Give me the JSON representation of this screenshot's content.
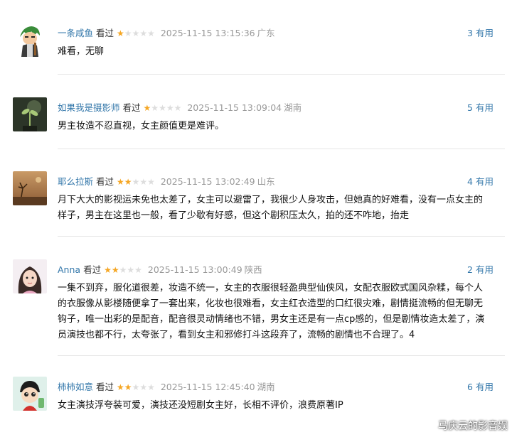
{
  "comments": [
    {
      "user": "一条咸鱼",
      "status": "看过",
      "rating": 1,
      "time": "2025-11-15 13:15:36",
      "location": "广东",
      "votes": "3",
      "vote_label": "有用",
      "text": "难看，无聊",
      "avatar": "anime-character-avatar"
    },
    {
      "user": "如果我是摄影师",
      "status": "看过",
      "rating": 1,
      "time": "2025-11-15 13:09:04",
      "location": "湖南",
      "votes": "5",
      "vote_label": "有用",
      "text": "男主妆造不忍直视，女主颜值更是难评。",
      "avatar": "plant-photo-avatar"
    },
    {
      "user": "耶么拉斯",
      "status": "看过",
      "rating": 2,
      "time": "2025-11-15 13:02:49",
      "location": "山东",
      "votes": "4",
      "vote_label": "有用",
      "text": "月下大大的影视运未免也太差了，女主可以避雷了，我很少人身攻击，但她真的好难看，没有一点女主的样子，男主在这里也一般，看了少歇有好感，但这个剧积压太久，拍的还不咋地，抬走",
      "avatar": "desert-tree-avatar"
    },
    {
      "user": "Anna",
      "status": "看过",
      "rating": 2,
      "time": "2025-11-15 13:00:49",
      "location": "陕西",
      "votes": "2",
      "vote_label": "有用",
      "text": "一集不到弃，服化道很差，妆造不统一，女主的衣服很轻盈典型仙侠风，女配衣服欧式国风杂糅，每个人的衣服像从影楼随便拿了一套出来，化妆也很难看，女主红衣造型的口红很灾难，剧情挺流畅的但无聊无钩子，唯一出彩的是配音，配音很灵动情绪也不错，男女主还是有一点cp感的，但是剧情妆造太差了，演员演技也都不行，太夸张了，看到女主和邪修打斗这段弃了，流畅的剧情也不合理了。4",
      "avatar": "girl-portrait-avatar"
    },
    {
      "user": "柿柿如意",
      "status": "看过",
      "rating": 2,
      "time": "2025-11-15 12:45:40",
      "location": "湖南",
      "votes": "6",
      "vote_label": "有用",
      "text": "女主演技浮夸装可爱，演技还没短剧女主好，长相不评价，浪费原著IP",
      "avatar": "cartoon-child-avatar"
    }
  ],
  "watermark": "马庆云的影音娱",
  "colors": {
    "link": "#3377aa",
    "star_on": "#f5a623",
    "star_off": "#dddddd",
    "meta": "#999999"
  }
}
